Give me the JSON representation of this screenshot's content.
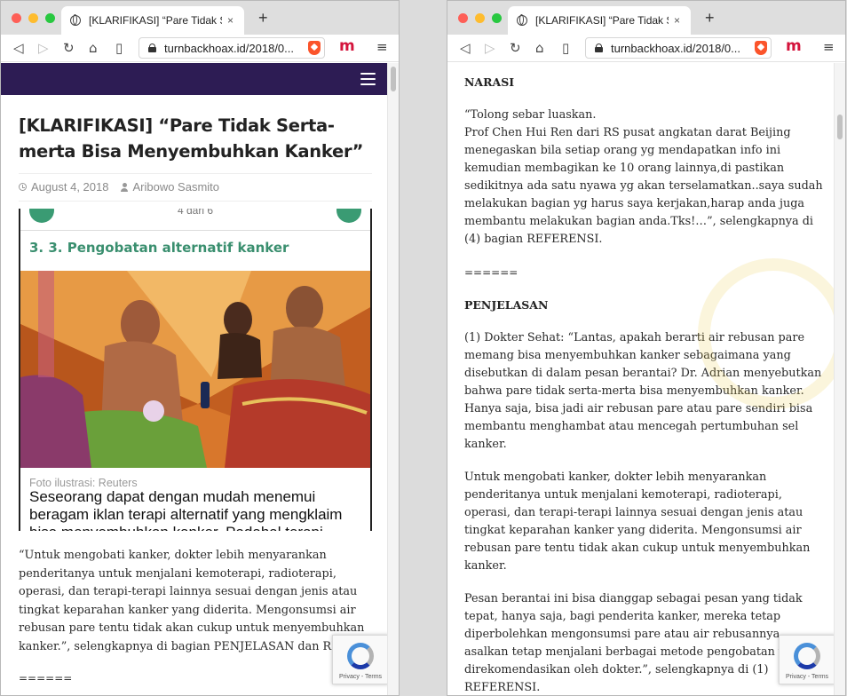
{
  "browser": {
    "tab_title": "[KLARIFIKASI] “Pare Tidak Serta-m",
    "tab_close": "×",
    "new_tab": "+",
    "url": "turnbackhoax.id/2018/0...",
    "icons": {
      "back": "◁",
      "forward": "▷",
      "reload": "↻",
      "home": "⌂",
      "bookmark": "▯",
      "menu": "≡",
      "ext": "m"
    }
  },
  "left": {
    "article_title": "[KLARIFIKASI] “Pare Tidak Serta-merta Bisa Menyembuhkan Kanker”",
    "date": "August 4, 2018",
    "author": "Aribowo Sasmito",
    "embed": {
      "pager": "4 dari 6",
      "heading": "3. 3. Pengobatan alternatif kanker",
      "photo_caption": "Foto ilustrasi: Reuters",
      "caption_line1": "Seseorang dapat dengan mudah menemui",
      "caption_line2": "beragam iklan terapi alternatif yang mengklaim",
      "caption_line3": "bisa menyembuhkan kanker. Padahal terapi"
    },
    "body_lines": [
      "“Untuk mengobati kanker, dokter lebih menyarankan",
      "penderitanya untuk menjalani kemoterapi, radioterapi,",
      "operasi, dan terapi-terapi lainnya sesuai dengan jenis atau",
      "tingkat keparahan kanker yang diderita. Mengonsumsi air",
      "rebusan pare tentu tidak akan cukup untuk menyembuhkan",
      "kanker.”, selengkapnya di bagian PENJELASAN dan REFERENSI."
    ],
    "separator": "======"
  },
  "right": {
    "narasi_heading": "NARASI",
    "narasi_lines": [
      "“Tolong sebar luaskan.",
      "Prof Chen Hui Ren dari RS pusat angkatan darat Beijing",
      "menegaskan bila setiap orang yg mendapatkan info ini",
      "kemudian membagikan ke 10 orang lainnya,di pastikan",
      "sedikitnya ada satu nyawa yg akan terselamatkan..saya sudah",
      "melakukan bagian yg harus saya kerjakan,harap anda juga",
      "membantu melakukan bagian anda.Tks!…”, selengkapnya di",
      "(4) bagian REFERENSI."
    ],
    "separator": "======",
    "penjelasan_heading": "PENJELASAN",
    "p1_lines": [
      "(1) Dokter Sehat: “Lantas, apakah berarti air rebusan pare",
      "memang bisa menyembuhkan kanker sebagaimana yang",
      "disebutkan di dalam pesan berantai? Dr. Adrian menyebutkan",
      "bahwa pare tidak serta-merta bisa menyembuhkan kanker.",
      "Hanya saja, bisa jadi air rebusan pare atau pare sendiri bisa",
      "membantu menghambat atau mencegah pertumbuhan sel",
      "kanker."
    ],
    "p2_lines": [
      "Untuk mengobati kanker, dokter lebih menyarankan",
      "penderitanya untuk menjalani kemoterapi, radioterapi,",
      "operasi, dan terapi-terapi lainnya sesuai dengan jenis atau",
      "tingkat keparahan kanker yang diderita. Mengonsumsi air",
      "rebusan pare tentu tidak akan cukup untuk menyembuhkan",
      "kanker."
    ],
    "p3_lines": [
      "Pesan berantai ini bisa dianggap sebagai pesan yang tidak",
      "tepat, hanya saja, bagi penderita kanker, mereka tetap",
      "diperbolehkan mengonsumsi pare atau air rebusannya",
      "asalkan tetap menjalani berbagai metode pengobatan yang",
      "direkomendasikan oleh dokter.”, selengkapnya di (1)",
      "REFERENSI."
    ]
  },
  "recaptcha": {
    "label": "Privacy - Terms"
  }
}
